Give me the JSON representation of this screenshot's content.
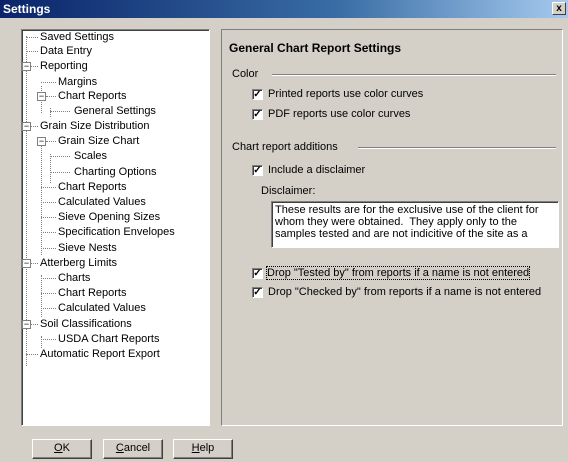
{
  "window": {
    "title": "Settings",
    "close_glyph": "x"
  },
  "tree": {
    "items": [
      {
        "label": "Saved Settings"
      },
      {
        "label": "Data Entry"
      },
      {
        "label": "Reporting",
        "expander": "−"
      },
      {
        "label": "Margins"
      },
      {
        "label": "Chart Reports",
        "expander": "−"
      },
      {
        "label": "General Settings"
      },
      {
        "label": "Grain Size Distribution",
        "expander": "−"
      },
      {
        "label": "Grain Size Chart",
        "expander": "−"
      },
      {
        "label": "Scales"
      },
      {
        "label": "Charting Options"
      },
      {
        "label": "Chart Reports"
      },
      {
        "label": "Calculated Values"
      },
      {
        "label": "Sieve Opening Sizes"
      },
      {
        "label": "Specification Envelopes"
      },
      {
        "label": "Sieve Nests"
      },
      {
        "label": "Atterberg Limits",
        "expander": "−"
      },
      {
        "label": "Charts"
      },
      {
        "label": "Chart Reports"
      },
      {
        "label": "Calculated Values"
      },
      {
        "label": "Soil Classifications",
        "expander": "−"
      },
      {
        "label": "USDA Chart Reports"
      },
      {
        "label": "Automatic Report Export"
      }
    ]
  },
  "panel": {
    "heading": "General Chart Report Settings",
    "color_group": {
      "label": "Color",
      "options": [
        {
          "label": "Printed reports use color curves",
          "checked": true
        },
        {
          "label": "PDF reports use color curves",
          "checked": true
        }
      ]
    },
    "additions_group": {
      "label": "Chart report additions",
      "include_disclaimer": {
        "label": "Include a disclaimer",
        "checked": true
      },
      "disclaimer_label": "Disclaimer:",
      "disclaimer_text": "These results are for the exclusive use of the client for whom they were obtained.  They apply only to the samples tested and are not indicitive of the site as a",
      "drop_tested_by": {
        "label": "Drop \"Tested by\" from reports if a name is not entered",
        "checked": true
      },
      "drop_checked_by": {
        "label": "Drop \"Checked by\" from reports if a name is not entered",
        "checked": true
      }
    }
  },
  "buttons": {
    "ok": {
      "accel": "O",
      "rest": "K"
    },
    "cancel": {
      "accel": "C",
      "rest": "ancel"
    },
    "help": {
      "accel": "H",
      "rest": "elp"
    }
  },
  "check_glyph": "✓",
  "colors": {
    "title_gradient_start": "#0a246a",
    "title_gradient_end": "#a6caf0",
    "face": "#d4d0c8"
  }
}
